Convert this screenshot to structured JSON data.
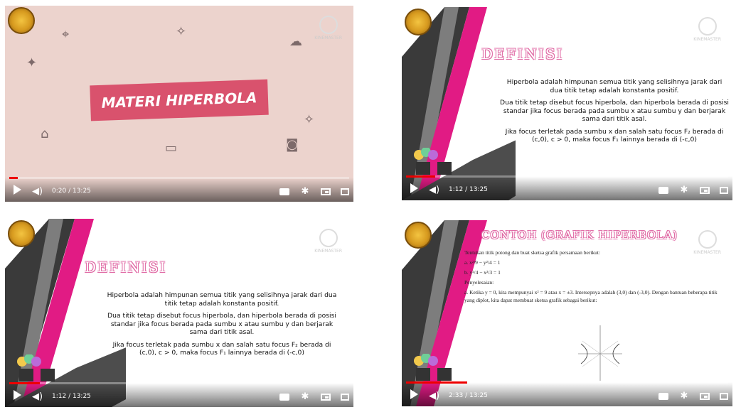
{
  "panels": [
    {
      "title": "MATERI HIPERBOLA",
      "time": "0:20 / 13:25",
      "progress": 0.025
    },
    {
      "heading": "DEFINISI",
      "paragraphs": [
        "Hiperbola adalah himpunan semua titik yang selisihnya jarak dari dua titik tetap adalah konstanta positif.",
        "Dua titik tetap disebut focus hiperbola, dan hiperbola berada di posisi standar jika focus berada pada sumbu x atau sumbu y dan berjarak sama dari titik asal.",
        "Jika focus terletak pada sumbu x dan salah satu focus F₂ berada di (c,0), c > 0, maka focus F₁ lainnya berada di (-c,0)"
      ],
      "time": "1:12 / 13:25",
      "progress": 0.09
    },
    {
      "heading": "DEFINISI",
      "paragraphs": [
        "Hiperbola adalah himpunan semua titik yang selisihnya jarak dari dua titik tetap adalah konstanta positif.",
        "Dua titik tetap disebut focus hiperbola, dan hiperbola berada di posisi standar jika focus berada pada sumbu x atau sumbu y dan berjarak sama dari titik asal.",
        "Jika focus terletak pada sumbu x dan salah satu focus F₂ berada di (c,0), c > 0, maka focus F₁ lainnya berada di (-c,0)"
      ],
      "time": "1:12 / 13:25",
      "progress": 0.09
    },
    {
      "heading": "CONTOH (GRAFIK HIPERBOLA)",
      "lines": [
        "Tentukan titik potong dan buat sketsa grafik persamaan berikut:",
        "a. x²/9 − y²/4 = 1",
        "b. y²/4 − x²/3 = 1",
        "Penyelesaian:",
        "a. Ketika y = 0, kita mempunyai x² = 9 atau x = ±3. Intersepnya adalah (3,0) dan (-3,0). Dengan bantuan beberapa titik yang diplot, kita dapat membuat sketsa grafik sebagai berikut:"
      ],
      "time": "2:33 / 13:25",
      "progress": 0.19
    }
  ],
  "watermark": "KINEMASTER",
  "colors": {
    "accent": "#e11b84",
    "progress": "#ee0000",
    "banner": "#d9526d"
  }
}
